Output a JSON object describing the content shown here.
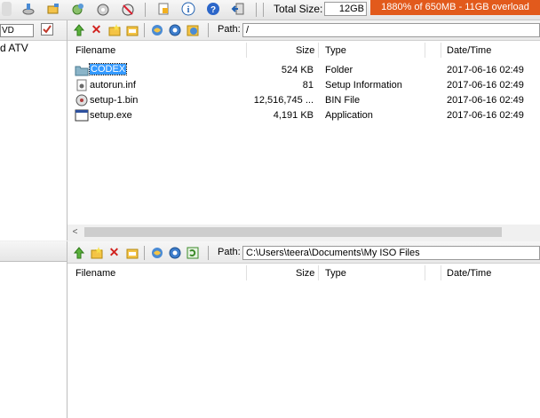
{
  "toolbar": {
    "total_size_label": "Total Size:",
    "total_size_value": "12GB",
    "overload_text": "1880% of 650MB - 11GB overload",
    "overload_color": "#e25a1c"
  },
  "disc_panel": {
    "disc_field_value": "VD",
    "tree_item": "d ATV"
  },
  "image_pane": {
    "path_label": "Path:",
    "path_value": "/",
    "columns": {
      "filename": "Filename",
      "size": "Size",
      "type": "Type",
      "date": "Date/Time"
    },
    "rows": [
      {
        "name": "CODEX",
        "size": "524 KB",
        "type": "Folder",
        "date": "2017-06-16 02:49",
        "icon": "folder-icon",
        "selected": true
      },
      {
        "name": "autorun.inf",
        "size": "81",
        "type": "Setup Information",
        "date": "2017-06-16 02:49",
        "icon": "setup-info-icon",
        "selected": false
      },
      {
        "name": "setup-1.bin",
        "size": "12,516,745 ...",
        "type": "BIN File",
        "date": "2017-06-16 02:49",
        "icon": "disc-file-icon",
        "selected": false
      },
      {
        "name": "setup.exe",
        "size": "4,191 KB",
        "type": "Application",
        "date": "2017-06-16 02:49",
        "icon": "application-icon",
        "selected": false
      }
    ]
  },
  "local_pane": {
    "path_label": "Path:",
    "path_value": "C:\\Users\\teera\\Documents\\My ISO Files",
    "columns": {
      "filename": "Filename",
      "size": "Size",
      "type": "Type",
      "date": "Date/Time"
    }
  }
}
